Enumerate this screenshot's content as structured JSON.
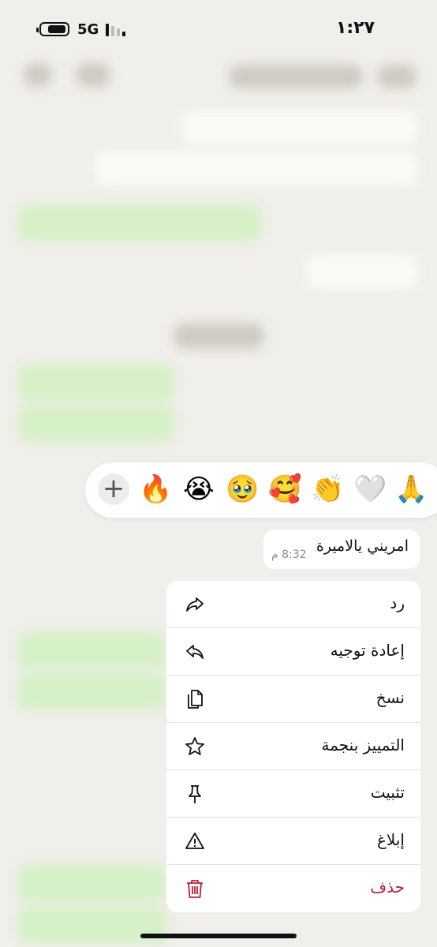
{
  "status_bar": {
    "network": "5G",
    "time": "١:٢٧"
  },
  "reactions": {
    "add_label": "+",
    "emojis": [
      "🙏",
      "🤍",
      "👏",
      "🥰",
      "🥹",
      "😭",
      "🔥"
    ]
  },
  "message": {
    "text": "امريني يالاميرة",
    "time": "8:32 م"
  },
  "menu": {
    "items": [
      {
        "label": "رد",
        "icon": "reply-icon"
      },
      {
        "label": "إعادة توجيه",
        "icon": "forward-icon"
      },
      {
        "label": "نسخ",
        "icon": "copy-icon"
      },
      {
        "label": "التمييز بنجمة",
        "icon": "star-icon"
      },
      {
        "label": "تثبيت",
        "icon": "pin-icon"
      },
      {
        "label": "إبلاغ",
        "icon": "report-icon"
      },
      {
        "label": "حذف",
        "icon": "trash-icon",
        "color": "#b5233a"
      }
    ]
  }
}
